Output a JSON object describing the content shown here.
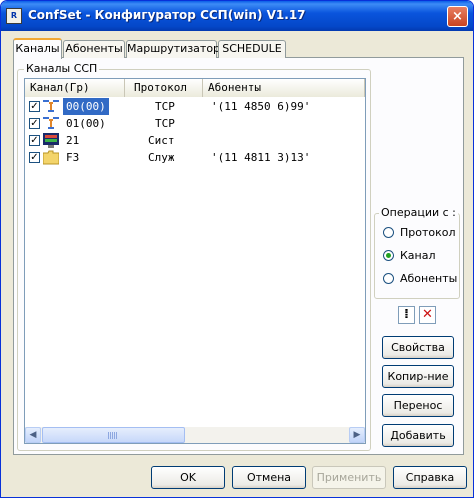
{
  "window": {
    "title": "ConfSet - Конфигуратор  ССП(win)  V1.17",
    "icon": "app-icon",
    "close": "×"
  },
  "tabs": [
    {
      "label": "Каналы",
      "active": true
    },
    {
      "label": "Абоненты",
      "active": false
    },
    {
      "label": "Маршрутизатор",
      "active": false
    },
    {
      "label": "SCHEDULE",
      "active": false
    }
  ],
  "group": {
    "title": "Каналы ССП"
  },
  "list": {
    "columns": [
      "Канал(Гр)",
      "Протокол",
      "Абоненты"
    ],
    "rows": [
      {
        "checked": "✓",
        "icon": "network-icon",
        "channel": "00(00)",
        "protocol": "TCP",
        "subscribers": "'(11 4850 6)99'",
        "selected": true
      },
      {
        "checked": "✓",
        "icon": "network-icon",
        "channel": "01(00)",
        "protocol": "TCP",
        "subscribers": "",
        "selected": false
      },
      {
        "checked": "✓",
        "icon": "system-monitor-icon",
        "channel": "21",
        "protocol": "Сист",
        "subscribers": "",
        "selected": false
      },
      {
        "checked": "✓",
        "icon": "folder-icon",
        "channel": "F3",
        "protocol": "Служ",
        "subscribers": "'(11 4811 3)13'",
        "selected": false
      }
    ]
  },
  "operations": {
    "title": "Операции с :",
    "options": [
      {
        "label": "Протокол",
        "selected": false
      },
      {
        "label": "Канал",
        "selected": true
      },
      {
        "label": "Абоненты",
        "selected": false
      }
    ]
  },
  "icon_buttons": {
    "dots": "⁞",
    "delete": "✕"
  },
  "side_buttons": {
    "properties": "Свойства",
    "copy": "Копир-ние",
    "move": "Перенос",
    "add": "Добавить"
  },
  "footer": {
    "ok": "OK",
    "cancel": "Отмена",
    "apply": "Применить",
    "help": "Справка"
  },
  "colors": {
    "accent": "#316ac5",
    "titlebar": "#0a55dd"
  }
}
